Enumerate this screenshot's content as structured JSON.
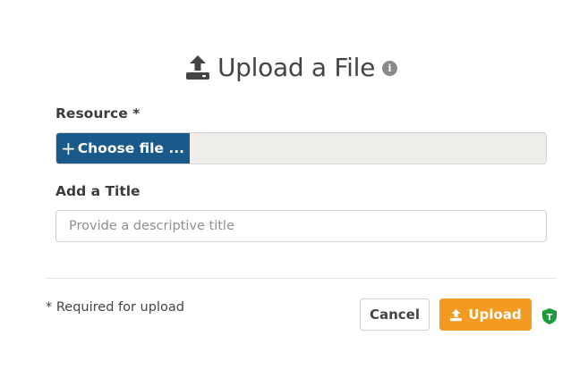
{
  "dialog": {
    "title": "Upload a File",
    "title_icon": "upload-icon",
    "info_icon_glyph": "i"
  },
  "form": {
    "resource_label": "Resource *",
    "choose_file_label": "Choose file ...",
    "file_name": "",
    "title_label": "Add a Title",
    "title_value": "",
    "title_placeholder": "Provide a descriptive title"
  },
  "footer": {
    "required_note": "* Required for upload",
    "cancel_label": "Cancel",
    "upload_label": "Upload",
    "security_badge_letter": "T"
  },
  "colors": {
    "choose_button": "#1a5a8a",
    "upload_button": "#f39a22",
    "shield": "#1e9a3a"
  }
}
